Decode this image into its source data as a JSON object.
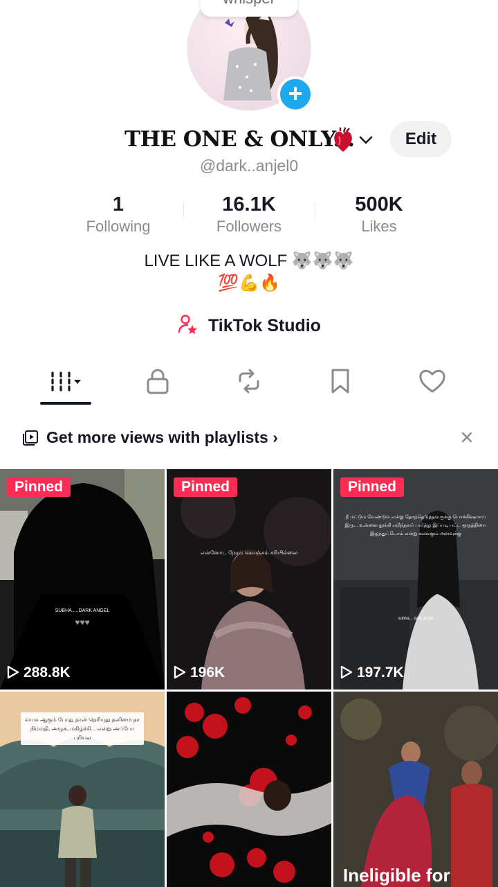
{
  "profile": {
    "nickname_pill": "whisper",
    "display_name": "THE ONE & ONLY...",
    "username": "@dark..anjel0",
    "edit_label": "Edit"
  },
  "stats": {
    "following": {
      "value": "1",
      "label": "Following"
    },
    "followers": {
      "value": "16.1K",
      "label": "Followers"
    },
    "likes": {
      "value": "500K",
      "label": "Likes"
    }
  },
  "bio": {
    "line1": "LIVE LIKE A WOLF",
    "line1_emoji": "🐺🐺🐺",
    "line2_emoji": "💯💪🔥"
  },
  "studio": {
    "label": "TikTok Studio"
  },
  "tabs": [
    "videos-grid",
    "private",
    "reposts",
    "favorites",
    "liked"
  ],
  "playlist_banner": {
    "text": "Get more views with playlists"
  },
  "videos": [
    {
      "pinned": "Pinned",
      "views": "288.8K",
      "overlay": "SUBHA.....DARK ANGEL"
    },
    {
      "pinned": "Pinned",
      "views": "196K",
      "overlay": "என்னோட நேரம் கொஞ்சம் சரியில்லை"
    },
    {
      "pinned": "Pinned",
      "views": "197.7K",
      "overlay": "நீ மட்டும் வேண்டும் என்று தோந்தெடுத்தவருக்கு பொக்கிஷமாய் இரு... உன்னை தூக்கி எறிந்தவர் பார்த்து இப்படி பட்ட ஒருத்தியை இழந்துட்டோம் என்று கலங்கும் அளவுக்கு",
      "overlay2": "subha... dark angel"
    },
    {
      "caption": "வயசு ஆகும் போது தான் தெரியுது தனிமை தா நிம்மதி, அழுக, மகிழ்ச்சி... என்று அப்போ புரியல"
    },
    {},
    {
      "ineligible": "Ineligible for"
    }
  ],
  "colors": {
    "accent": "#fe2c55",
    "badge_blue": "#20a8ef",
    "text": "#161823",
    "muted": "#8a8b91"
  }
}
